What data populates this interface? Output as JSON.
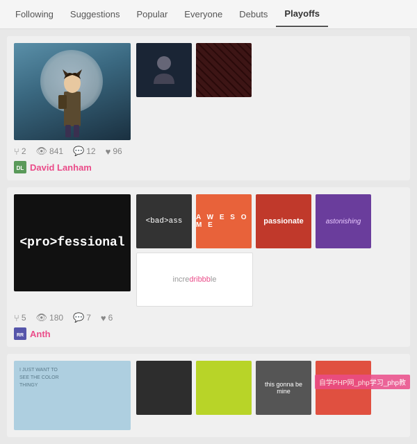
{
  "nav": {
    "items": [
      {
        "label": "Following",
        "active": false
      },
      {
        "label": "Suggestions",
        "active": false
      },
      {
        "label": "Popular",
        "active": false
      },
      {
        "label": "Everyone",
        "active": false
      },
      {
        "label": "Debuts",
        "active": false
      },
      {
        "label": "Playoffs",
        "active": true
      }
    ]
  },
  "cards": [
    {
      "id": "card1",
      "meta": {
        "likes": "2",
        "views": "841",
        "comments": "12",
        "hearts": "96"
      },
      "author": {
        "name": "David Lanham",
        "avatar_color": "#5a9a5a",
        "avatar_initials": "DL"
      }
    },
    {
      "id": "card2",
      "meta": {
        "likes": "5",
        "views": "180",
        "comments": "7",
        "hearts": "6"
      },
      "author": {
        "name": "Anth",
        "avatar_color": "#5555aa",
        "avatar_initials": "RR"
      }
    },
    {
      "id": "card3",
      "meta": {
        "likes": "",
        "views": "",
        "comments": "",
        "hearts": ""
      },
      "author": {
        "name": "",
        "avatar_color": "#999",
        "avatar_initials": ""
      }
    }
  ],
  "watermark": "自学PHP网_php学习_php教"
}
